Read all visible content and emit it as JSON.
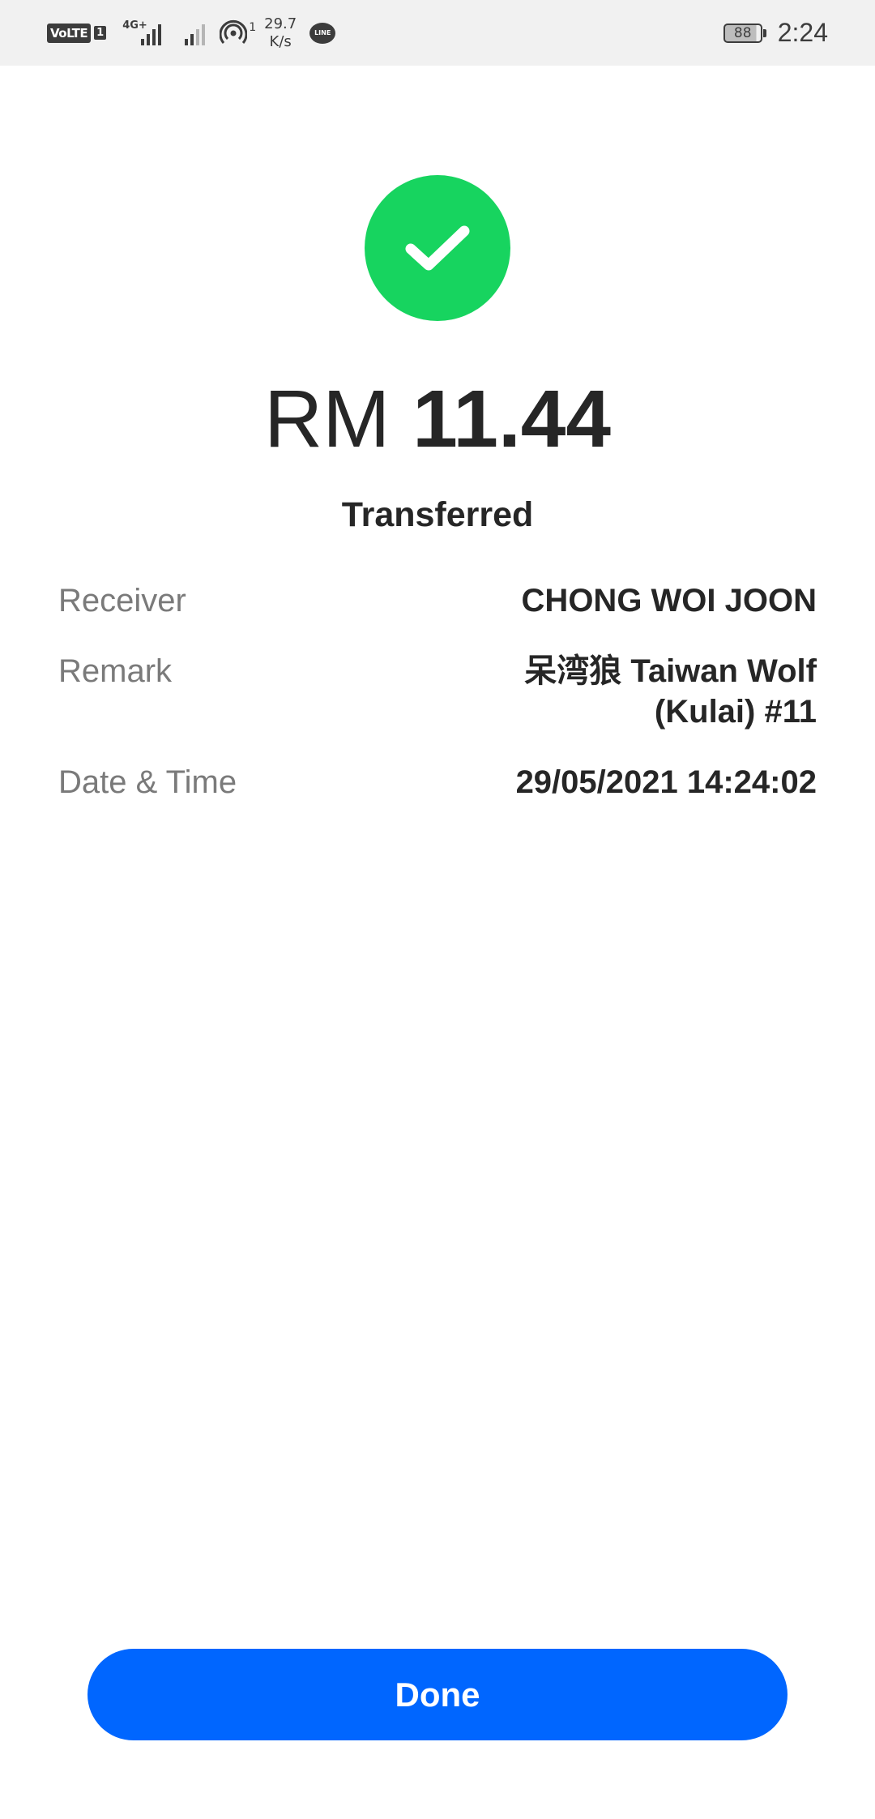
{
  "status_bar": {
    "volte_label": "VoLTE",
    "sim_badge": "1",
    "network_type": "4G+",
    "hotspot_count": "1",
    "speed_value": "29.7",
    "speed_unit": "K/s",
    "line_app_label": "LINE",
    "battery_level": "88",
    "time": "2:24"
  },
  "result": {
    "currency": "RM",
    "amount": "11.44",
    "status": "Transferred",
    "accent_color": "#17d45f"
  },
  "details": [
    {
      "label": "Receiver",
      "value": "CHONG WOI JOON"
    },
    {
      "label": "Remark",
      "value": "呆湾狼 Taiwan Wolf (Kulai) #11"
    },
    {
      "label": "Date & Time",
      "value": "29/05/2021 14:24:02"
    }
  ],
  "actions": {
    "done_label": "Done",
    "button_color": "#0066ff"
  }
}
